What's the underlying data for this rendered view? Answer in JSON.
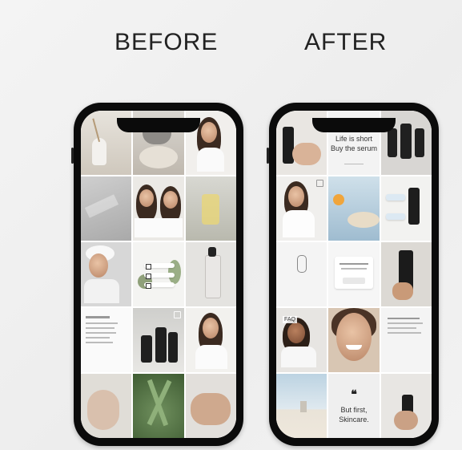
{
  "headings": {
    "before": "BEFORE",
    "after": "AFTER"
  },
  "after_tiles": {
    "quote1_line1": "Life is short",
    "quote1_line2": "Buy the serum",
    "quote2_line1": "But first,",
    "quote2_line2": "Skincare.",
    "faq": "FAQ"
  },
  "icons": {
    "quote_mark": "❝",
    "check": "✓"
  },
  "colors": {
    "background": "#efefef",
    "phone_frame": "#0b0b0b",
    "heading_text": "#222222"
  }
}
